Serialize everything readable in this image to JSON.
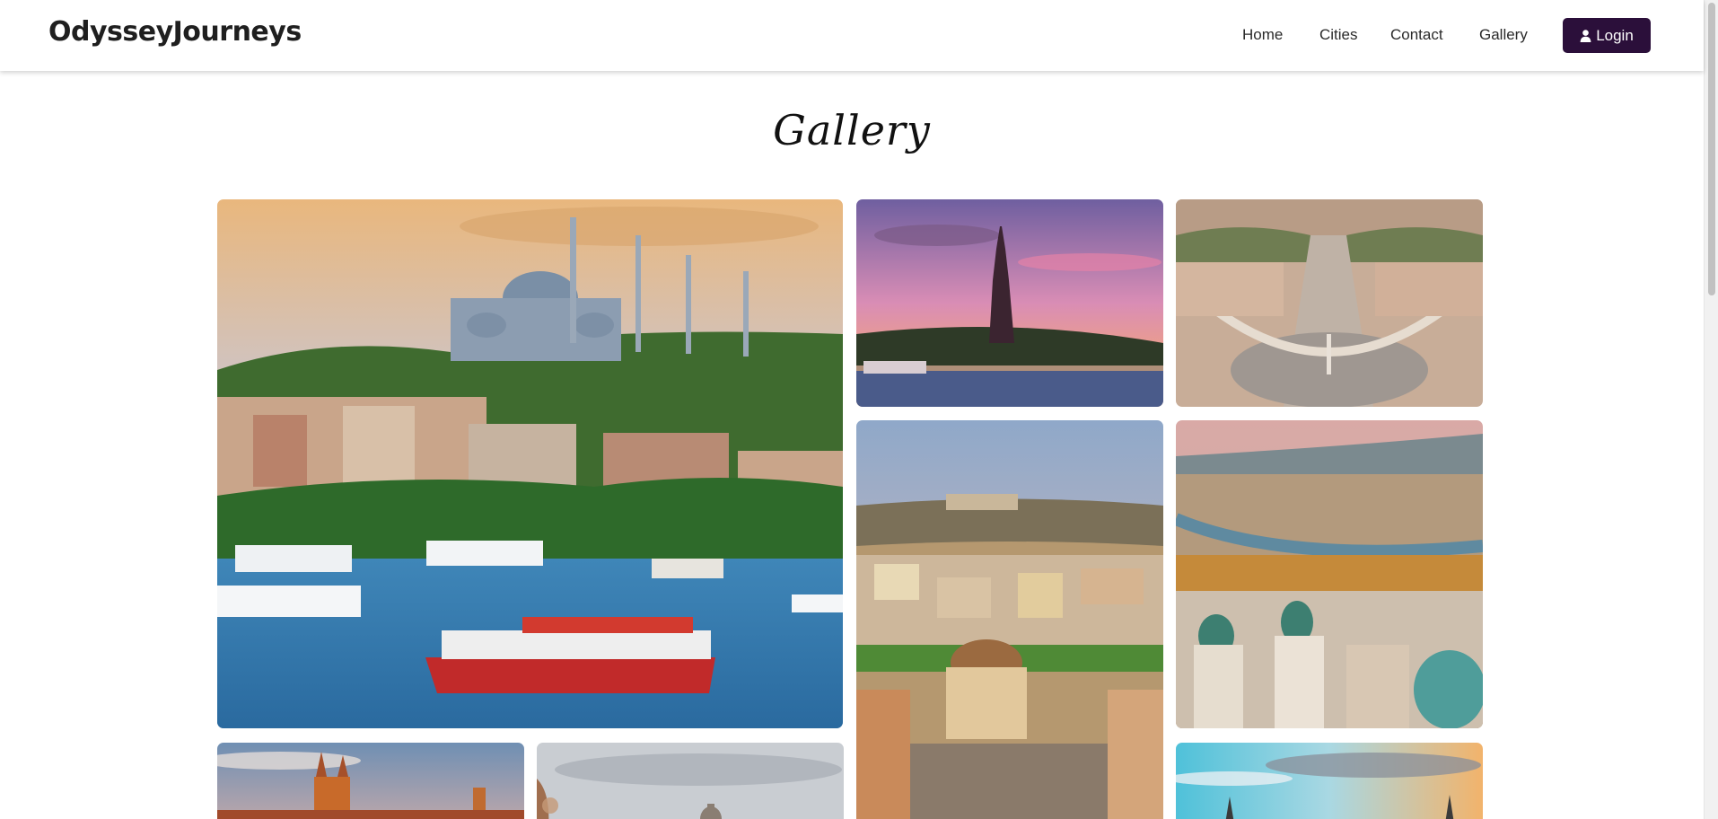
{
  "brand": "OdysseyJourneys",
  "nav": {
    "home": "Home",
    "cities": "Cities",
    "contact": "Contact",
    "gallery": "Gallery",
    "login": "Login",
    "login_icon": "user-icon"
  },
  "page": {
    "title": "Gallery"
  },
  "colors": {
    "accent": "#2b0f3a",
    "navbar_bg": "#ffffff",
    "page_bg": "#ffffff"
  },
  "gallery": {
    "images": [
      {
        "subject": "Istanbul mosque and ferry"
      },
      {
        "subject": "Eiffel Tower at sunset"
      },
      {
        "subject": "St. Peter's Square aerial view"
      },
      {
        "subject": "Athens Acropolis cityscape"
      },
      {
        "subject": "Salzburg old town domes"
      },
      {
        "subject": "Prague castle"
      },
      {
        "subject": "City dome view"
      },
      {
        "subject": "City skyline at sunset"
      }
    ]
  }
}
